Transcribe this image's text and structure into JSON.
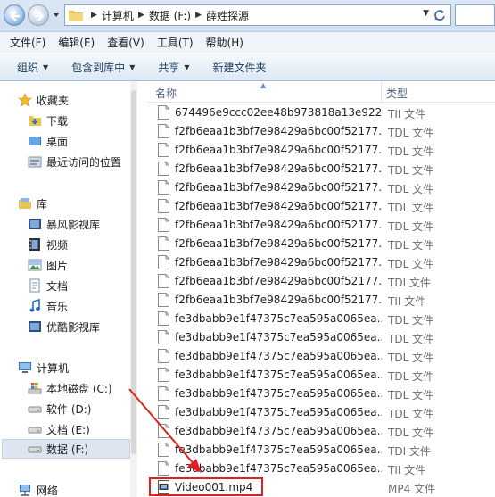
{
  "address": {
    "crumbs": [
      "计算机",
      "数据 (F:)",
      "薛姓探源"
    ]
  },
  "menu": [
    "文件(F)",
    "编辑(E)",
    "查看(V)",
    "工具(T)",
    "帮助(H)"
  ],
  "toolbar": {
    "organize": "组织",
    "include_library": "包含到库中",
    "share": "共享",
    "new_folder": "新建文件夹"
  },
  "nav": {
    "favorites": "收藏夹",
    "downloads": "下载",
    "desktop": "桌面",
    "recent": "最近访问的位置",
    "libraries": "库",
    "baofeng": "暴风影视库",
    "videos": "视频",
    "pictures": "图片",
    "documents": "文档",
    "music": "音乐",
    "youku": "优酷影视库",
    "computer": "计算机",
    "drive_c": "本地磁盘 (C:)",
    "drive_d": "软件 (D:)",
    "drive_e": "文档 (E:)",
    "drive_f": "数据 (F:)",
    "network": "网络"
  },
  "columns": {
    "name": "名称",
    "type": "类型"
  },
  "files": [
    {
      "name": "674496e9ccc02ee48b973818a13e922...",
      "type": "TII 文件"
    },
    {
      "name": "f2fb6eaa1b3bf7e98429a6bc00f52177...",
      "type": "TDL 文件"
    },
    {
      "name": "f2fb6eaa1b3bf7e98429a6bc00f52177...",
      "type": "TDL 文件"
    },
    {
      "name": "f2fb6eaa1b3bf7e98429a6bc00f52177...",
      "type": "TDL 文件"
    },
    {
      "name": "f2fb6eaa1b3bf7e98429a6bc00f52177...",
      "type": "TDL 文件"
    },
    {
      "name": "f2fb6eaa1b3bf7e98429a6bc00f52177...",
      "type": "TDL 文件"
    },
    {
      "name": "f2fb6eaa1b3bf7e98429a6bc00f52177...",
      "type": "TDL 文件"
    },
    {
      "name": "f2fb6eaa1b3bf7e98429a6bc00f52177...",
      "type": "TDL 文件"
    },
    {
      "name": "f2fb6eaa1b3bf7e98429a6bc00f52177...",
      "type": "TDL 文件"
    },
    {
      "name": "f2fb6eaa1b3bf7e98429a6bc00f52177...",
      "type": "TDI 文件"
    },
    {
      "name": "f2fb6eaa1b3bf7e98429a6bc00f52177...",
      "type": "TII 文件"
    },
    {
      "name": "fe3dbabb9e1f47375c7ea595a0065ea...",
      "type": "TDL 文件"
    },
    {
      "name": "fe3dbabb9e1f47375c7ea595a0065ea...",
      "type": "TDL 文件"
    },
    {
      "name": "fe3dbabb9e1f47375c7ea595a0065ea...",
      "type": "TDL 文件"
    },
    {
      "name": "fe3dbabb9e1f47375c7ea595a0065ea...",
      "type": "TDL 文件"
    },
    {
      "name": "fe3dbabb9e1f47375c7ea595a0065ea...",
      "type": "TDL 文件"
    },
    {
      "name": "fe3dbabb9e1f47375c7ea595a0065ea...",
      "type": "TDL 文件"
    },
    {
      "name": "fe3dbabb9e1f47375c7ea595a0065ea...",
      "type": "TDL 文件"
    },
    {
      "name": "fe3dbabb9e1f47375c7ea595a0065ea...",
      "type": "TDI 文件"
    },
    {
      "name": "fe3dbabb9e1f47375c7ea595a0065ea...",
      "type": "TII 文件"
    },
    {
      "name": "Video001.mp4",
      "type": "MP4 文件"
    }
  ],
  "colors": {
    "annotation": "#e02020"
  }
}
